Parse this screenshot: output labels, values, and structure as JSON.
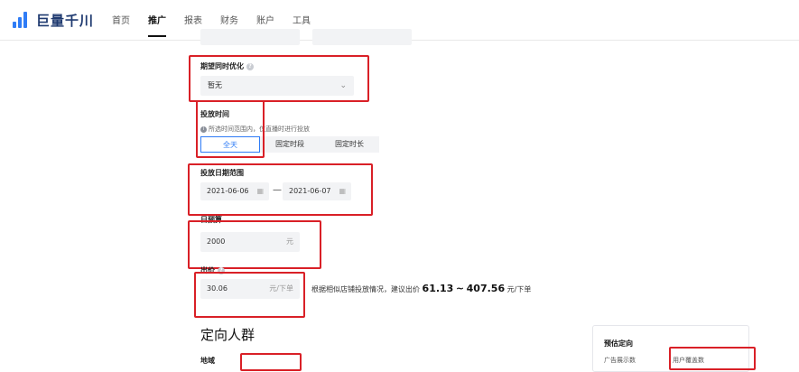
{
  "app": {
    "brand": "巨量千川",
    "logo_icon": "bar-chart-logo-icon"
  },
  "nav": {
    "items": [
      {
        "label": "首页",
        "active": false
      },
      {
        "label": "推广",
        "active": true
      },
      {
        "label": "报表",
        "active": false
      },
      {
        "label": "财务",
        "active": false
      },
      {
        "label": "账户",
        "active": false
      },
      {
        "label": "工具",
        "active": false
      }
    ]
  },
  "form": {
    "optimize": {
      "label": "期望同时优化",
      "value": "暂无"
    },
    "schedule": {
      "label": "投放时间",
      "hint": "所选时间范围内，仅直播时进行投放",
      "options": [
        "全天",
        "固定时段",
        "固定时长"
      ],
      "selected": "全天"
    },
    "date_range": {
      "label": "投放日期范围",
      "start": "2021-06-06",
      "end": "2021-06-07",
      "separator": "—"
    },
    "budget": {
      "label": "日预算",
      "value": "2000",
      "unit": "元"
    },
    "bid": {
      "label": "出价",
      "value": "30.06",
      "unit": "元/下单",
      "suggest_prefix": "根据相似店铺投放情况，建议出价",
      "suggest_min": "61.13",
      "suggest_sep": "~",
      "suggest_max": "407.56",
      "suggest_unit": "元/下单"
    }
  },
  "targeting": {
    "title": "定向人群",
    "region_label": "地域"
  },
  "estimate": {
    "title": "预估定向",
    "sub1": "广告展示数",
    "sub2": "用户覆盖数"
  },
  "annotation_color": "#d92027",
  "accent_color": "#2f7cf6"
}
